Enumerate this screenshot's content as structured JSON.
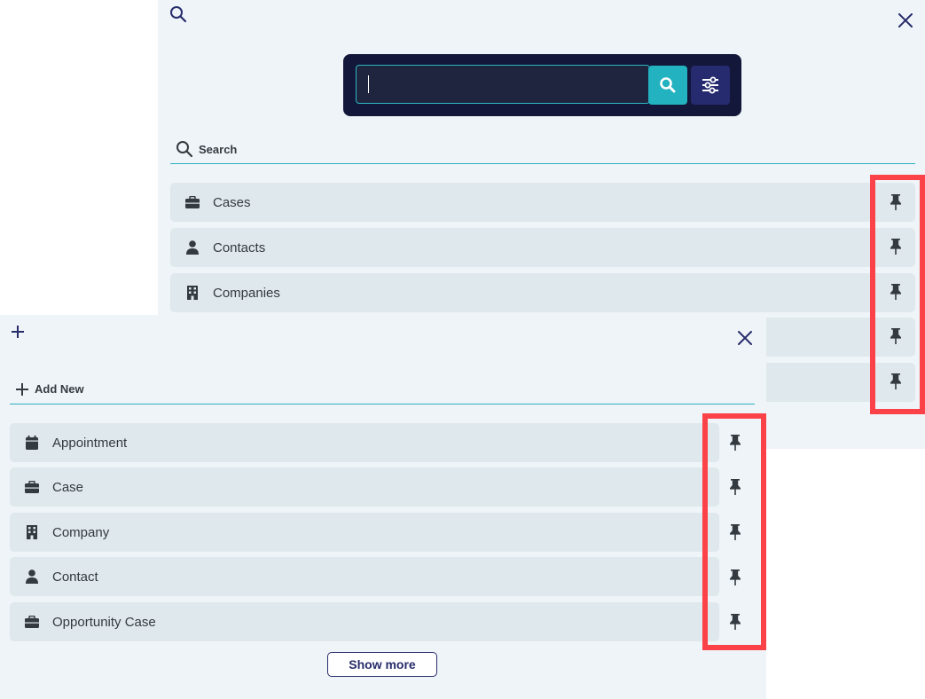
{
  "search_panel": {
    "search_field": {
      "value": "",
      "placeholder": ""
    },
    "section_label": "Search",
    "items": [
      {
        "label": "Cases",
        "icon": "briefcase-icon"
      },
      {
        "label": "Contacts",
        "icon": "person-icon"
      },
      {
        "label": "Companies",
        "icon": "building-icon"
      },
      {
        "label": "",
        "icon": ""
      },
      {
        "label": "",
        "icon": ""
      }
    ]
  },
  "add_panel": {
    "section_label": "Add New",
    "items": [
      {
        "label": "Appointment",
        "icon": "calendar-icon"
      },
      {
        "label": "Case",
        "icon": "briefcase-icon"
      },
      {
        "label": "Company",
        "icon": "building-icon"
      },
      {
        "label": "Contact",
        "icon": "person-icon"
      },
      {
        "label": "Opportunity Case",
        "icon": "briefcase-icon"
      }
    ],
    "show_more_label": "Show more"
  },
  "colors": {
    "panel_bg": "#eff4f8",
    "row_bg": "#dfe8ec",
    "search_bar_bg": "#131739",
    "search_button": "#22b2c0",
    "filter_button": "#262a6f",
    "accent_line": "#2bb0bd",
    "highlight": "#fb4248",
    "navy": "#272c6b"
  }
}
